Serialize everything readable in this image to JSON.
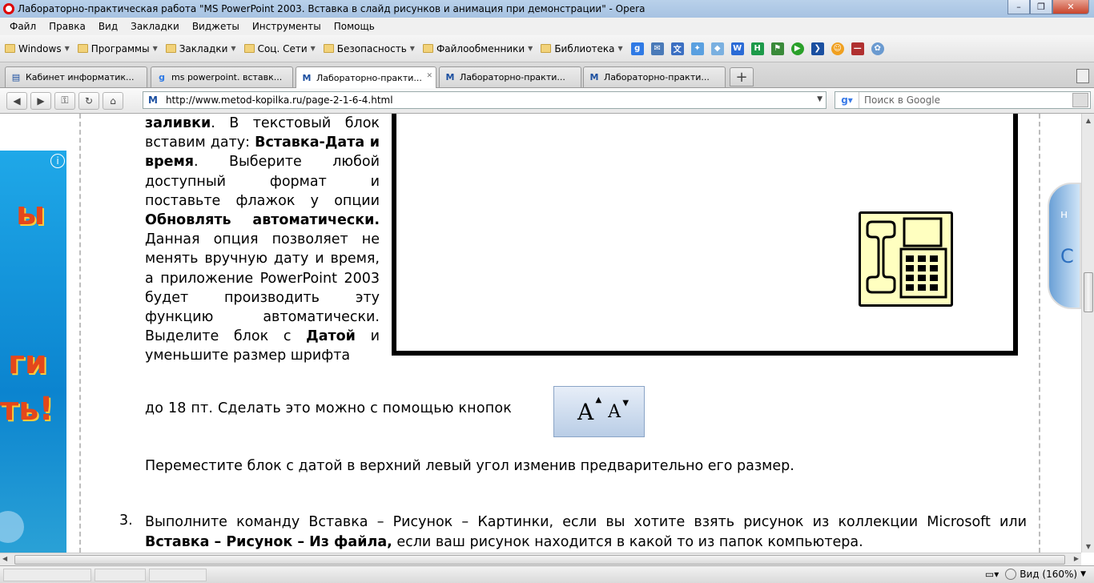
{
  "window": {
    "title": "Лабораторно-практическая работа \"MS PowerPoint 2003. Вставка в слайд рисунков и анимация при демонстрации\" - Opera",
    "minimize": "–",
    "maximize": "❐",
    "close": "✕"
  },
  "menu": [
    "Файл",
    "Правка",
    "Вид",
    "Закладки",
    "Виджеты",
    "Инструменты",
    "Помощь"
  ],
  "bookmarks": [
    "Windows",
    "Программы",
    "Закладки",
    "Соц. Сети",
    "Безопасность",
    "Файлообменники",
    "Библиотека"
  ],
  "tabs": [
    {
      "label": "Кабинет информатик...",
      "favicon": "document-icon"
    },
    {
      "label": "ms powerpoint. вставк...",
      "favicon": "google-icon"
    },
    {
      "label": "Лабораторно-практи...",
      "favicon": "M"
    },
    {
      "label": "Лабораторно-практи...",
      "favicon": "M"
    },
    {
      "label": "Лабораторно-практи...",
      "favicon": "M"
    }
  ],
  "active_tab": 2,
  "address": {
    "url": "http://www.metod-kopilka.ru/page-2-1-6-4.html"
  },
  "search": {
    "placeholder": "Поиск в Google"
  },
  "article": {
    "p1": {
      "t1": "заливки",
      "t2": ". В текстовый блок вставим дату: ",
      "t3": "Вставка-Дата и время",
      "t4": ". Выберите любой доступный формат и поставьте флажок у опции ",
      "t5": "Обновлять автоматически.",
      "t6": " Данная опция позволяет не менять вручную дату и время, а приложение PowerPoint 2003 будет производить эту функцию автоматически. Выделите блок с ",
      "t7": "Датой",
      "t8": " и уменьшите размер шрифта"
    },
    "line18": "до 18 пт. Сделать это можно с помощью кнопок",
    "font_buttons": {
      "grow": "A",
      "shrink": "A"
    },
    "move_line": "Переместите блок с датой в верхний левый угол изменив предварительно его размер.",
    "item3": {
      "num": "3.",
      "t1": "Выполните команду Вставка – Рисунок – Картинки, если вы хотите взять рисунок из коллекции Microsoft или ",
      "t2": "Вставка – Рисунок – Из файла,",
      "t3": " если ваш рисунок находится в какой то из папок компьютера."
    }
  },
  "ad": {
    "texts": [
      "ы",
      "ги",
      "ть!"
    ],
    "info": "i"
  },
  "side_widget": {
    "letters": [
      "н",
      "С"
    ]
  },
  "status": {
    "zoom": "Вид (160%)"
  }
}
